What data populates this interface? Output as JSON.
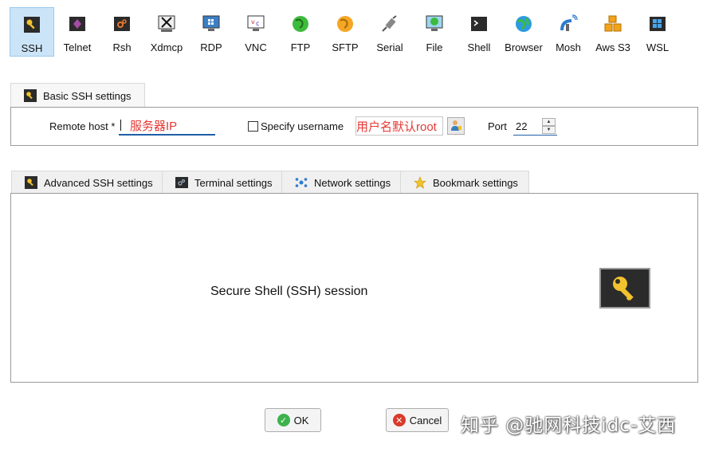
{
  "session_types": [
    {
      "label": "SSH",
      "icon": "key-icon",
      "active": true
    },
    {
      "label": "Telnet",
      "icon": "telnet-icon"
    },
    {
      "label": "Rsh",
      "icon": "rsh-icon"
    },
    {
      "label": "Xdmcp",
      "icon": "xdmcp-icon"
    },
    {
      "label": "RDP",
      "icon": "rdp-monitor-icon"
    },
    {
      "label": "VNC",
      "icon": "vnc-icon"
    },
    {
      "label": "FTP",
      "icon": "ftp-globe-icon"
    },
    {
      "label": "SFTP",
      "icon": "sftp-globe-icon"
    },
    {
      "label": "Serial",
      "icon": "serial-plug-icon"
    },
    {
      "label": "File",
      "icon": "file-monitor-icon"
    },
    {
      "label": "Shell",
      "icon": "shell-terminal-icon"
    },
    {
      "label": "Browser",
      "icon": "browser-globe-icon"
    },
    {
      "label": "Mosh",
      "icon": "mosh-satellite-icon"
    },
    {
      "label": "Aws S3",
      "icon": "aws-s3-cubes-icon"
    },
    {
      "label": "WSL",
      "icon": "wsl-windows-icon"
    }
  ],
  "basic_tab": {
    "label": "Basic SSH settings"
  },
  "basic": {
    "remote_host_label": "Remote host *",
    "remote_host_value": "服务器IP",
    "specify_username_label": "Specify username",
    "username_value": "用户名默认root",
    "port_label": "Port",
    "port_value": "22"
  },
  "advanced_tabs": [
    {
      "label": "Advanced SSH settings",
      "icon": "key-icon"
    },
    {
      "label": "Terminal settings",
      "icon": "terminal-icon"
    },
    {
      "label": "Network settings",
      "icon": "network-icon"
    },
    {
      "label": "Bookmark settings",
      "icon": "star-icon"
    }
  ],
  "session_caption": "Secure Shell (SSH) session",
  "buttons": {
    "ok": "OK",
    "cancel": "Cancel"
  },
  "watermark": "知乎 @驰网科技idc-艾西",
  "colors": {
    "accent": "#1f5fa8",
    "annotation_red": "#e53935",
    "selected_tab_bg": "#cce4f7"
  }
}
